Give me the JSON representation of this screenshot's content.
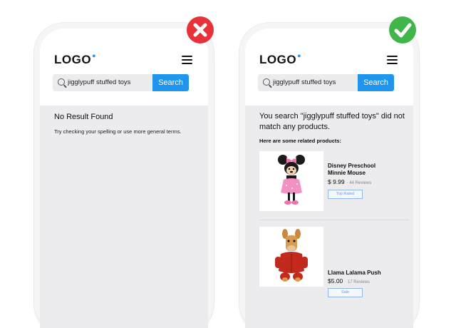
{
  "colors": {
    "accent": "#1f95ee",
    "wrong": "#e8323a",
    "correct": "#3fb54a"
  },
  "bad_example": {
    "status_icon": "x-icon",
    "header": {
      "logo": "LOGO",
      "menu_icon": "hamburger-icon"
    },
    "search": {
      "icon": "search-icon",
      "value": "jigglypuff stuffed toys",
      "button_label": "Search"
    },
    "result": {
      "title": "No Result Found",
      "subtitle": "Try checking your spelling or use more general terms."
    }
  },
  "good_example": {
    "status_icon": "check-icon",
    "header": {
      "logo": "LOGO",
      "menu_icon": "hamburger-icon"
    },
    "search": {
      "icon": "search-icon",
      "value": "jigglypuff stuffed toys",
      "button_label": "Search"
    },
    "result": {
      "message": "You search \"jigglypuff stuffed toys\" did not match any products.",
      "related_heading": "Here are some related products:",
      "products": [
        {
          "name": "Disney Preschool Minnie Mouse",
          "price": "$ 9.99",
          "reviews": "44 Reviews",
          "badge": "Top Rated",
          "image": "minnie-mouse-plush"
        },
        {
          "name": "Llama Lalama Push",
          "price": "$5.00",
          "reviews": "17 Reviews",
          "badge": "Sale",
          "image": "llama-plush"
        }
      ]
    }
  }
}
